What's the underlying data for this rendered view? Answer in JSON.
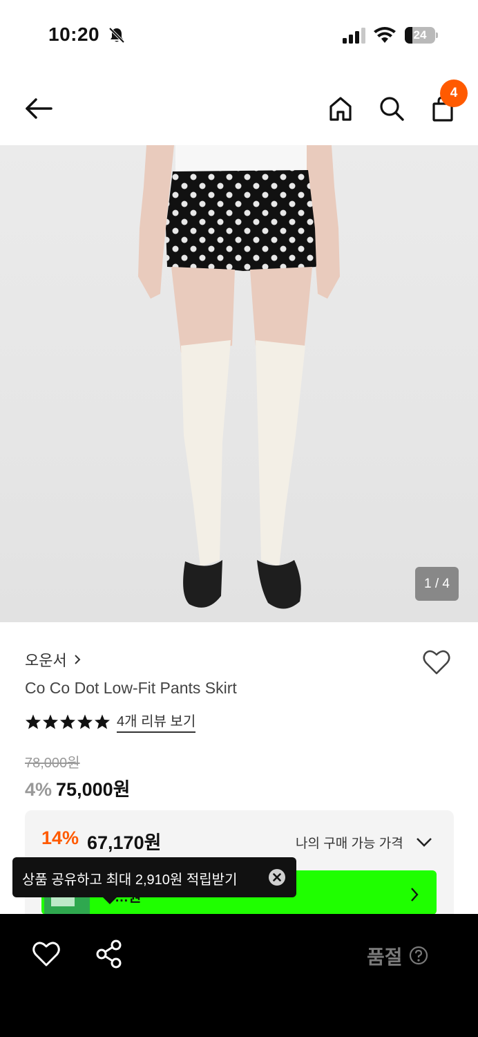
{
  "status_bar": {
    "time": "10:20",
    "battery": "24",
    "battery_level": 0.24,
    "icons": [
      "bell-slash-icon",
      "signal-icon",
      "wifi-icon",
      "battery-icon"
    ]
  },
  "nav": {
    "icons": [
      "arrow-left-icon",
      "home-icon",
      "search-icon",
      "shopping-bag-icon"
    ],
    "cart_count": "4"
  },
  "gallery": {
    "counter": "1 / 4"
  },
  "product": {
    "brand": "오운서",
    "title": "Co Co Dot Low-Fit Pants Skirt",
    "rating_stars": 5,
    "review_link": "4개 리뷰 보기",
    "original_price": "78,000원",
    "discount": "4%",
    "sale_price": "75,000원"
  },
  "purchase_box": {
    "my_discount": "14%",
    "my_price": "67,170원",
    "my_price_label": "나의 구매 가능 가격",
    "banner_text": "…원"
  },
  "tooltip": {
    "text": "상품 공유하고 최대 2,910원 적립받기"
  },
  "bottom_bar": {
    "status": "품절"
  },
  "colors": {
    "accent": "#ff5a00",
    "banner": "#1fff00",
    "bottom_bar": "#000000"
  }
}
